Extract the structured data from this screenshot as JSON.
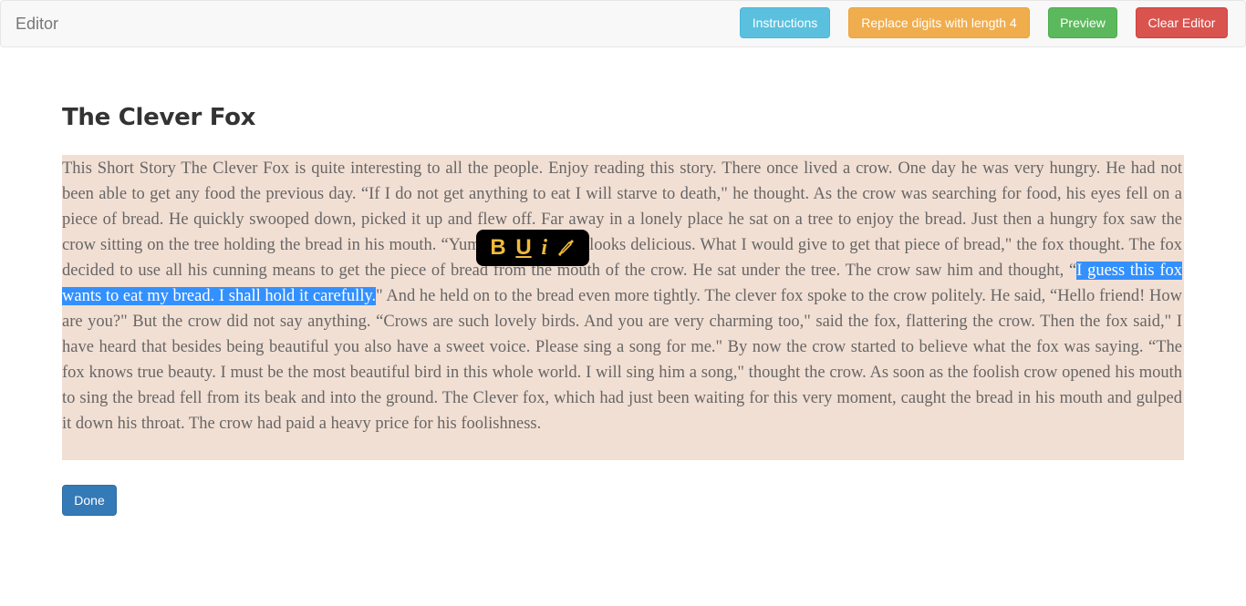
{
  "navbar": {
    "brand": "Editor",
    "buttons": {
      "instructions": "Instructions",
      "replace_digits": "Replace digits with length 4",
      "preview": "Preview",
      "clear": "Clear Editor"
    },
    "colors": {
      "instructions": "#5bc0de",
      "replace_digits": "#f0ad4e",
      "preview": "#5cb85c",
      "clear": "#d9534f"
    }
  },
  "story": {
    "title": "The Clever Fox",
    "text_before": "This Short Story The Clever Fox is quite interesting to all the people. Enjoy reading this story. There once lived a crow. One day he was very hungry. He had not been able to get any food the previous day. “If I do not get anything to eat I will starve to death,\" he thought. As the crow was searching for food, his eyes fell on a piece of bread. He quickly swooped down, picked it up and flew off. Far away in a lonely place he sat on a tree to enjoy the bread. Just then a hungry fox saw the crow sitting on the tree holding the bread in his mouth. “Yummy! That bread looks delicious. What I would give to get that piece of bread,\" the fox thought. The fox decided to use all his cunning means to get the piece of bread from the mouth of the crow. He sat under the tree. The crow saw him and thought, “",
    "selected_text": "I guess this fox wants to eat my bread. I shall hold it carefully.",
    "text_after": "\" And he held on to the bread even more tightly. The clever fox spoke to the crow politely. He said, “Hello friend! How are you?\" But the crow did not say anything. “Crows are such lovely birds. And you are very charming too,\" said the fox, flattering the crow. Then the fox said,\" I have heard that besides being beautiful you also have a sweet voice. Please sing a song for me.\" By now the crow started to believe what the fox was saying. “The fox knows true beauty. I must be the most beautiful bird in this whole world. I will sing him a song,\" thought the crow. As soon as the foolish crow opened his mouth to sing the bread fell from its beak and into the ground. The Clever fox, which had just been waiting for this very moment, caught the bread in his mouth and gulped it down his throat. The crow had paid a heavy price for his foolishness.",
    "background_color": "#f2dfd3",
    "selection_color": "#3390ff"
  },
  "toolbar": {
    "bold": "B",
    "underline": "U",
    "italic": "i",
    "color_icon": "eyedropper-icon",
    "accent": "#f0b93a"
  },
  "done_label": "Done"
}
